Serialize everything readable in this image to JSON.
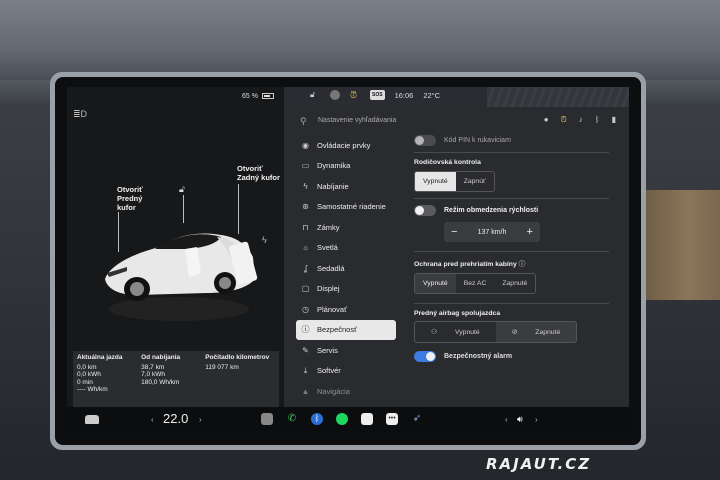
{
  "status": {
    "battery": "65 %",
    "time": "16:06",
    "outside_temp": "22°C",
    "sos_label": "SOS"
  },
  "car_panel": {
    "front_trunk_label": "Otvoriť\nPredný\nkufor",
    "rear_trunk_label": "Otvoriť\nZadný kufor"
  },
  "trip": {
    "columns": [
      {
        "header": "Aktuálna jazda",
        "lines": [
          "0,0 km",
          "0,0 kWh",
          "0 min",
          "---- Wh/km"
        ]
      },
      {
        "header": "Od nabíjania",
        "lines": [
          "38,7 km",
          "7,0 kWh",
          "180,0 Wh/km"
        ]
      },
      {
        "header": "Počítadlo kilometrov",
        "lines": [
          "119 077 km"
        ]
      }
    ]
  },
  "search": {
    "placeholder": "Nastavenie vyhľadávania"
  },
  "menu": {
    "items": [
      {
        "label": "Ovládacie prvky",
        "icon": "toggle-icon"
      },
      {
        "label": "Dynamika",
        "icon": "car-icon"
      },
      {
        "label": "Nabíjanie",
        "icon": "bolt-icon"
      },
      {
        "label": "Samostatné riadenie",
        "icon": "steering-wheel-icon"
      },
      {
        "label": "Zámky",
        "icon": "lock-icon"
      },
      {
        "label": "Svetlá",
        "icon": "sun-icon"
      },
      {
        "label": "Sedadlá",
        "icon": "seat-icon"
      },
      {
        "label": "Displej",
        "icon": "display-icon"
      },
      {
        "label": "Plánovať",
        "icon": "clock-icon"
      },
      {
        "label": "Bezpečnosť",
        "icon": "info-icon"
      },
      {
        "label": "Servis",
        "icon": "wrench-icon"
      },
      {
        "label": "Softvér",
        "icon": "download-icon"
      },
      {
        "label": "Navigácia",
        "icon": "nav-icon"
      }
    ],
    "active": "Bezpečnosť"
  },
  "settings": {
    "pin_label": "Kód PIN k rukaviciam",
    "parental_title": "Rodičovská kontrola",
    "parental_options": [
      "Vypnuté",
      "Zapnúť"
    ],
    "parental_selected": "Vypnuté",
    "speed_limit_label": "Režim obmedzenia rýchlosti",
    "speed_value": "137 km/h",
    "cabin_title": "Ochrana pred prehriatím kabíny",
    "cabin_options": [
      "Vypnuté",
      "Bez AC",
      "Zapnuté"
    ],
    "cabin_selected": "Vypnuté",
    "airbag_title": "Predný airbag spolujazdca",
    "airbag_options": [
      "Vypnuté",
      "Zapnuté"
    ],
    "airbag_selected": "Zapnuté",
    "alarm_label": "Bezpečnostný alarm"
  },
  "dock": {
    "cabin_temp": "22.0"
  },
  "watermark": "RAJAUT.CZ"
}
